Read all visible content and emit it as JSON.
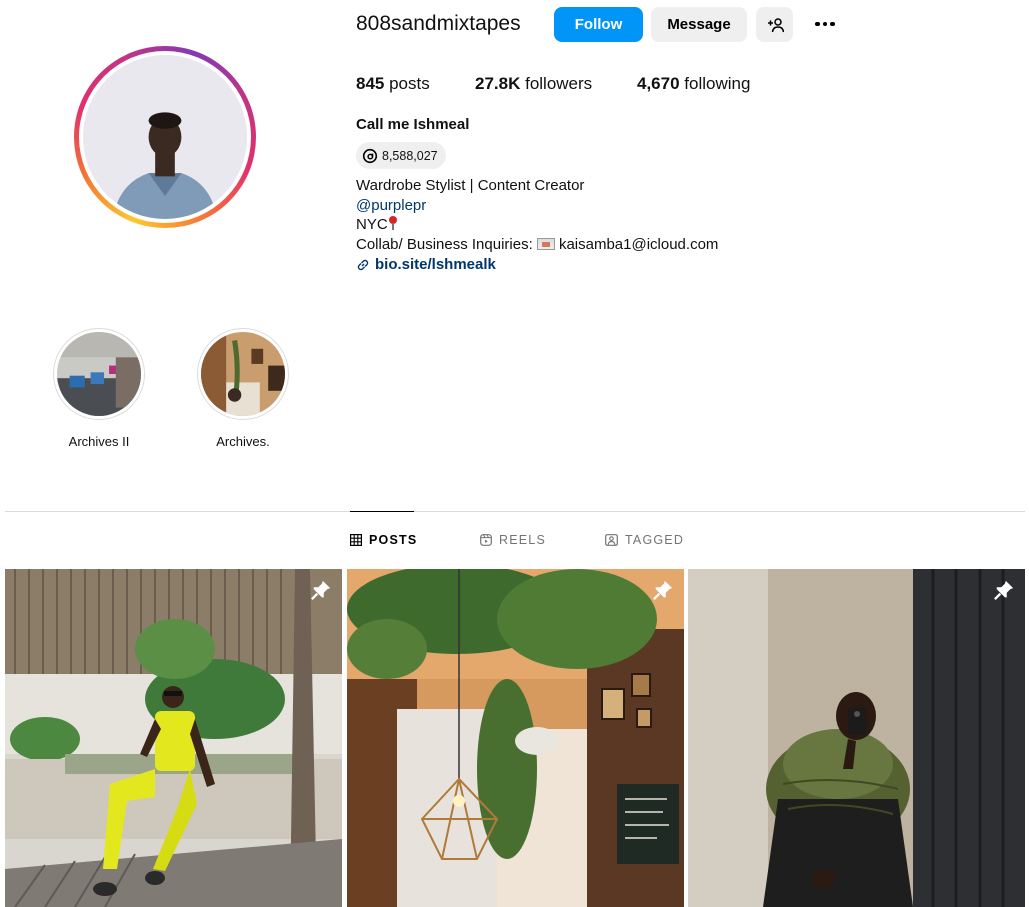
{
  "profile": {
    "username": "808sandmixtapes",
    "follow_label": "Follow",
    "message_label": "Message",
    "add_user_icon": "person-plus-icon",
    "more_icon": "more-options-icon"
  },
  "stats": {
    "posts_count": "845",
    "posts_label": " posts",
    "followers_count": "27.8K",
    "followers_label": " followers",
    "following_count": "4,670",
    "following_label": " following"
  },
  "bio": {
    "full_name": "Call me Ishmeal",
    "threads_count": "8,588,027",
    "line1": "Wardrobe Stylist | Content Creator",
    "mention": "@purplepr",
    "location": "NYC",
    "business_prefix": "Collab/ Business Inquiries: ",
    "business_email": "kaisamba1@icloud.com",
    "link": "bio.site/lshmealk"
  },
  "highlights": [
    {
      "label": "Archives II"
    },
    {
      "label": "Archives."
    }
  ],
  "tabs": [
    {
      "label": "POSTS",
      "active": true,
      "icon": "grid-icon"
    },
    {
      "label": "REELS",
      "active": false,
      "icon": "reels-icon"
    },
    {
      "label": "TAGGED",
      "active": false,
      "icon": "tagged-icon"
    }
  ],
  "posts": [
    {
      "pinned": true,
      "icon": "pin-icon"
    },
    {
      "pinned": true,
      "icon": "pin-icon"
    },
    {
      "pinned": true,
      "icon": "pin-icon"
    }
  ],
  "colors": {
    "accent": "#0095f6",
    "link": "#00376b",
    "muted": "#737373",
    "button_bg": "#efefef"
  }
}
